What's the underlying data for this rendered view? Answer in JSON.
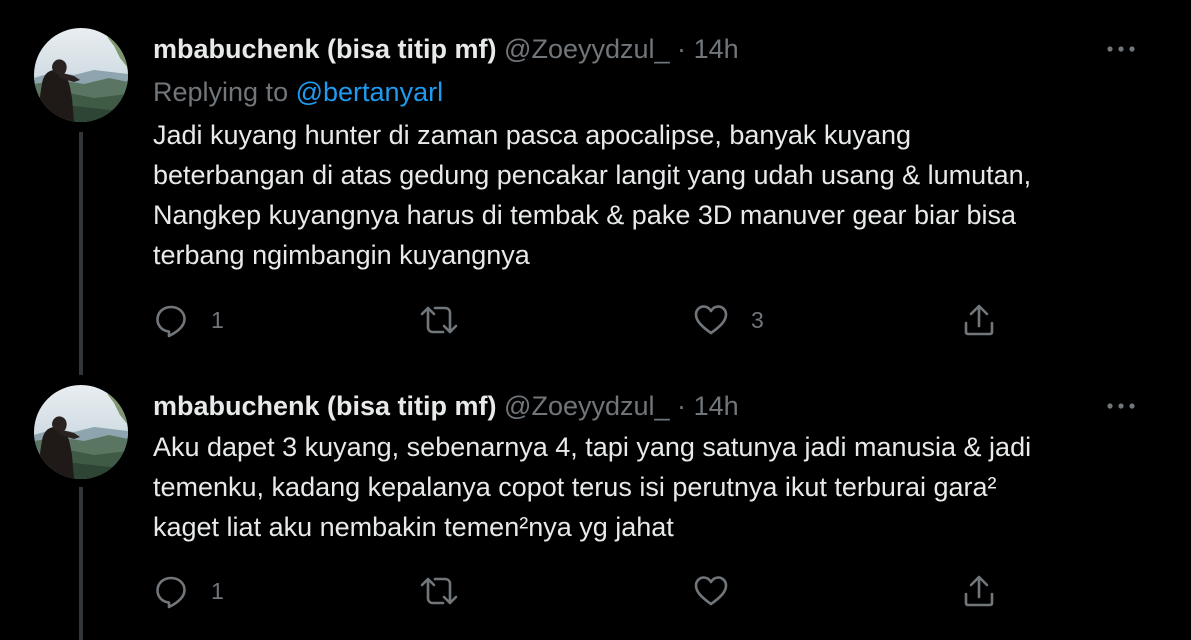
{
  "colors": {
    "background": "#000000",
    "text": "#e7e9ea",
    "muted": "#71767b",
    "link": "#1d9bf0",
    "thread_line": "#333639"
  },
  "tweets": [
    {
      "display_name": "mbabuchenk (bisa titip mf)",
      "handle": "@Zoeyydzul_",
      "separator": "·",
      "time": "14h",
      "replying_prefix": "Replying to",
      "replying_to": "@bertanyarl",
      "lines": [
        "Jadi kuyang hunter di zaman pasca apocalipse, banyak kuyang",
        "beterbangan di atas gedung pencakar langit yang udah usang & lumutan,",
        "Nangkep kuyangnya harus di tembak & pake 3D manuver gear biar bisa",
        "terbang ngimbangin kuyangnya"
      ],
      "reply_count": "1",
      "retweet_count": "",
      "like_count": "3",
      "icons": [
        "reply-icon",
        "retweet-icon",
        "like-icon",
        "share-icon",
        "more-icon"
      ]
    },
    {
      "display_name": "mbabuchenk (bisa titip mf)",
      "handle": "@Zoeyydzul_",
      "separator": "·",
      "time": "14h",
      "lines": [
        "Aku dapet 3 kuyang, sebenarnya 4, tapi yang satunya jadi manusia & jadi",
        "temenku, kadang kepalanya copot terus isi perutnya ikut terburai gara²",
        "kaget liat aku nembakin temen²nya yg jahat"
      ],
      "reply_count": "1",
      "retweet_count": "",
      "like_count": "",
      "icons": [
        "reply-icon",
        "retweet-icon",
        "like-icon",
        "share-icon",
        "more-icon"
      ]
    }
  ]
}
